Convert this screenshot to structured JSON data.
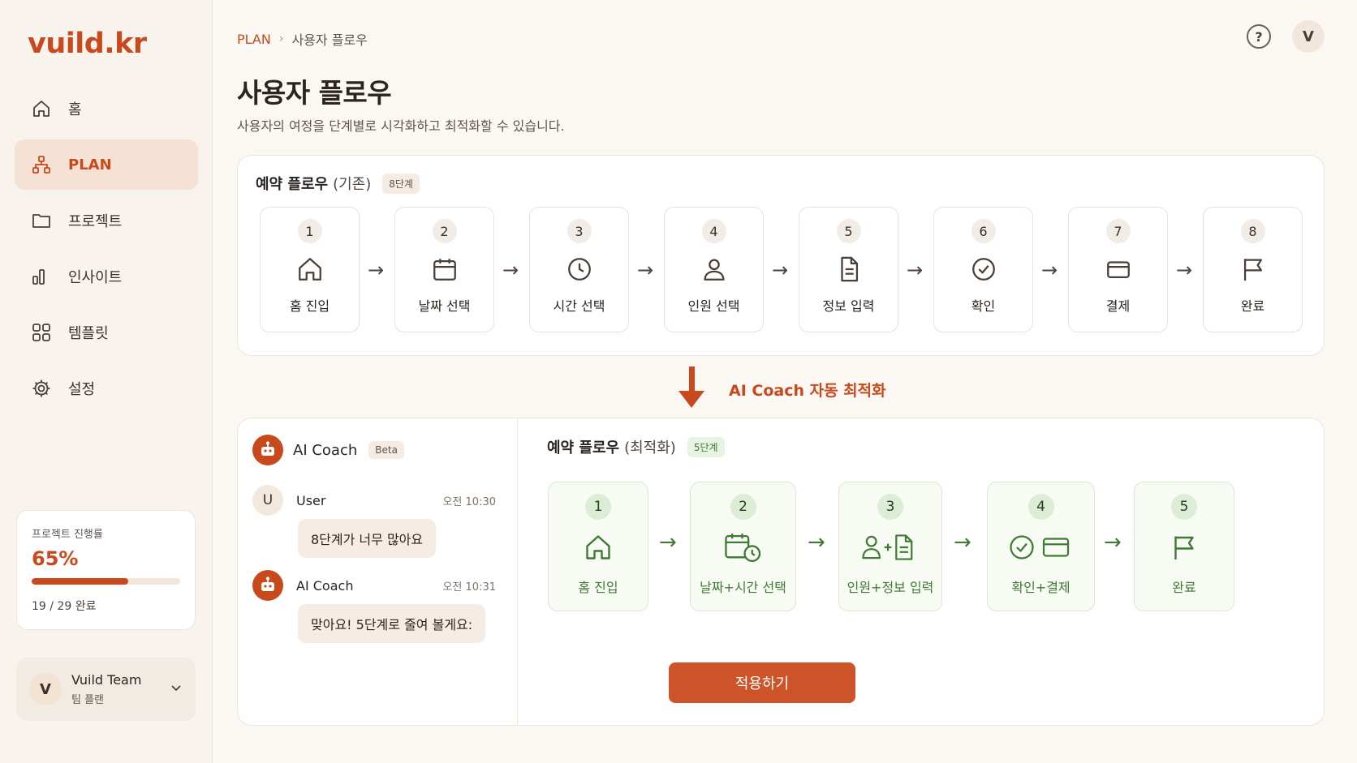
{
  "app": {
    "logo": "vuild.kr"
  },
  "sidebar": {
    "items": [
      {
        "label": "홈",
        "icon": "home-icon",
        "active": false
      },
      {
        "label": "PLAN",
        "icon": "sitemap-icon",
        "active": true
      },
      {
        "label": "프로젝트",
        "icon": "folder-icon",
        "active": false
      },
      {
        "label": "인사이트",
        "icon": "bar-chart-icon",
        "active": false
      },
      {
        "label": "템플릿",
        "icon": "grid-icon",
        "active": false
      },
      {
        "label": "설정",
        "icon": "gear-icon",
        "active": false
      }
    ],
    "progress": {
      "label": "프로젝트 진행률",
      "value_text": "65%",
      "value": 0.65,
      "count": "19 / 29 완료"
    },
    "team": {
      "avatar": "V",
      "name": "Vuild Team",
      "plan": "팀 플랜"
    }
  },
  "header": {
    "breadcrumb_root": "PLAN",
    "breadcrumb_current": "사용자 플로우",
    "help": "?",
    "user_initial": "V",
    "title": "사용자 플로우",
    "subtitle": "사용자의 여정을 단계별로 시각화하고 최적화할 수 있습니다."
  },
  "original_flow": {
    "title": "예약 플로우",
    "qualifier": "(기존)",
    "badge": "8단계",
    "steps": [
      {
        "num": "1",
        "label": "홈 진입",
        "icon": "home-icon"
      },
      {
        "num": "2",
        "label": "날짜 선택",
        "icon": "calendar-icon"
      },
      {
        "num": "3",
        "label": "시간 선택",
        "icon": "clock-icon"
      },
      {
        "num": "4",
        "label": "인원 선택",
        "icon": "person-icon"
      },
      {
        "num": "5",
        "label": "정보 입력",
        "icon": "document-icon"
      },
      {
        "num": "6",
        "label": "확인",
        "icon": "check-circle-icon"
      },
      {
        "num": "7",
        "label": "결제",
        "icon": "card-icon"
      },
      {
        "num": "8",
        "label": "완료",
        "icon": "flag-icon"
      }
    ]
  },
  "optimize_banner": {
    "text": "AI Coach 자동 최적화"
  },
  "coach": {
    "title": "AI Coach",
    "badge": "Beta",
    "messages": [
      {
        "avatar": "U",
        "name": "User",
        "time": "오전 10:30",
        "text": "8단계가 너무 많아요"
      },
      {
        "name": "AI Coach",
        "time": "오전 10:31",
        "text": "맞아요! 5단계로 줄여 볼게요:"
      }
    ]
  },
  "optimized_flow": {
    "title": "예약 플로우",
    "qualifier": "(최적화)",
    "badge": "5단계",
    "steps": [
      {
        "num": "1",
        "label": "홈 진입",
        "icon": "home-icon"
      },
      {
        "num": "2",
        "label": "날짜+시간 선택",
        "icon": "calendar-clock-icon"
      },
      {
        "num": "3",
        "label": "인원+정보 입력",
        "icon": "person-plus-document-icon"
      },
      {
        "num": "4",
        "label": "확인+결제",
        "icon": "check-card-icon"
      },
      {
        "num": "5",
        "label": "완료",
        "icon": "flag-icon"
      }
    ],
    "apply_label": "적용하기"
  },
  "colors": {
    "accent": "#c8491c",
    "green": "#3f7a32",
    "background": "#fbf8f4"
  }
}
